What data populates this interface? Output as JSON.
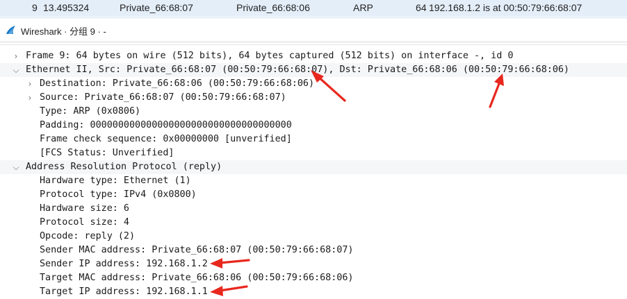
{
  "packet_list": {
    "row": {
      "number": "9",
      "time": "13.495324",
      "source": "Private_66:68:07",
      "destination": "Private_66:68:06",
      "protocol": "ARP",
      "length": "64",
      "info": "192.168.1.2 is at 00:50:79:66:68:07"
    }
  },
  "window": {
    "title": "Wireshark · 分组 9 · -",
    "icon": "wireshark-fin-icon"
  },
  "details": {
    "frame": {
      "label": "Frame 9: 64 bytes on wire (512 bits), 64 bytes captured (512 bits) on interface -, id 0",
      "expanded": false
    },
    "ethernet": {
      "label": "Ethernet II, Src: Private_66:68:07 (00:50:79:66:68:07), Dst: Private_66:68:06 (00:50:79:66:68:06)",
      "expanded": true,
      "fields": {
        "destination": "Destination: Private_66:68:06 (00:50:79:66:68:06)",
        "source": "Source: Private_66:68:07 (00:50:79:66:68:07)",
        "type": "Type: ARP (0x0806)",
        "padding": "Padding: 000000000000000000000000000000000000",
        "fcs": "Frame check sequence: 0x00000000 [unverified]",
        "fcs_status": "[FCS Status: Unverified]"
      }
    },
    "arp": {
      "label": "Address Resolution Protocol (reply)",
      "expanded": true,
      "fields": {
        "hardware_type": "Hardware type: Ethernet (1)",
        "protocol_type": "Protocol type: IPv4 (0x0800)",
        "hardware_size": "Hardware size: 6",
        "protocol_size": "Protocol size: 4",
        "opcode": "Opcode: reply (2)",
        "sender_mac": "Sender MAC address: Private_66:68:07 (00:50:79:66:68:07)",
        "sender_ip": "Sender IP address: 192.168.1.2",
        "target_mac": "Target MAC address: Private_66:68:06 (00:50:79:66:68:06)",
        "target_ip": "Target IP address: 192.168.1.1"
      }
    }
  },
  "icons": {
    "collapsed": "chevron-right-icon",
    "expanded": "chevron-down-icon"
  },
  "annotation_color": "#e8281e"
}
